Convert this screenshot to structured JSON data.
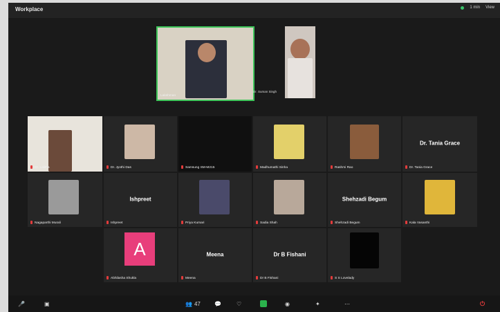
{
  "window": {
    "title": "Workplace"
  },
  "top_right": {
    "label_1": "1 min",
    "label_2": "View"
  },
  "speaker": {
    "name": "Lakshman"
  },
  "self_view": {
    "name": "Dr. Suman Singh"
  },
  "participants": [
    {
      "name": "Dr. Lalitha"
    },
    {
      "name": "Dr. Jyothi Das"
    },
    {
      "name": "Samsung SM-M215"
    },
    {
      "name": "Madhumathi Sinha"
    },
    {
      "name": "Rashmi Rao"
    },
    {
      "name": "Dr. Tania Grace",
      "tile_text": "Dr. Tania Grace"
    },
    {
      "name": "Nagaparthi Murali"
    },
    {
      "name": "Ishpreet",
      "tile_text": "Ishpreet"
    },
    {
      "name": "Priya Kumari"
    },
    {
      "name": "Sadia Shah"
    },
    {
      "name": "Shehzadi Begum",
      "tile_text": "Shehzadi Begum"
    },
    {
      "name": "Kala Vasanthi"
    },
    {
      "name": "Abhilasha Shukla",
      "avatar_letter": "A"
    },
    {
      "name": "Meena",
      "tile_text": "Meena"
    },
    {
      "name": "Dr B Fishani",
      "tile_text": "Dr B Fishani"
    },
    {
      "name": "S S Lovelady"
    }
  ],
  "toolbar": {
    "mute_label": "",
    "video_label": "",
    "participants_count": "47",
    "leave_label": "End"
  },
  "colors": {
    "accent_green": "#39c46b",
    "mute_red": "#e23b3b",
    "avatar_pink": "#e83e7b"
  }
}
